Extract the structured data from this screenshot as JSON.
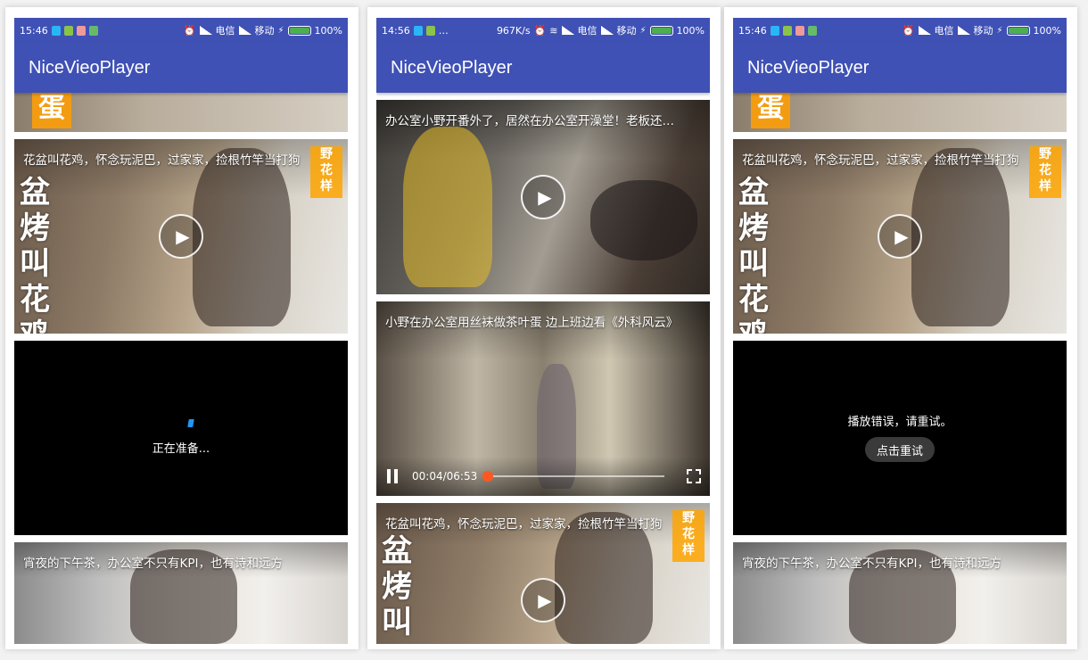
{
  "screens": [
    {
      "status": {
        "time": "15:46",
        "carrier1": "电信",
        "carrier2": "移动",
        "battery": "100%"
      },
      "app_title": "NiceVieoPlayer",
      "cards": {
        "flower_title": "花盆叫花鸡，怀念玩泥巴，过家家，捡根竹竿当打狗",
        "flower_poster": [
          "盆",
          "烤",
          "叫",
          "花",
          "鸡"
        ],
        "preparing": "正在准备...",
        "tea_title": "宵夜的下午茶，办公室不只有KPI，也有诗和远方",
        "dan_char": "蛋"
      }
    },
    {
      "status": {
        "time": "14:56",
        "speed": "967K/s",
        "carrier1": "电信",
        "carrier2": "移动",
        "battery": "100%"
      },
      "app_title": "NiceVieoPlayer",
      "cards": {
        "pig_title": "办公室小野开番外了，居然在办公室开澡堂！老板还…",
        "tea_egg_title": "小野在办公室用丝袜做茶叶蛋 边上班边看《外科风云》",
        "position": "00:04/06:53",
        "progress": 0.01,
        "flower_title": "花盆叫花鸡，怀念玩泥巴，过家家，捡根竹竿当打狗",
        "flower_poster": [
          "盆",
          "烤",
          "叫"
        ]
      }
    },
    {
      "status": {
        "time": "15:46",
        "carrier1": "电信",
        "carrier2": "移动",
        "battery": "100%"
      },
      "app_title": "NiceVieoPlayer",
      "cards": {
        "flower_title": "花盆叫花鸡，怀念玩泥巴，过家家，捡根竹竿当打狗",
        "flower_poster": [
          "盆",
          "烤",
          "叫",
          "花",
          "鸡"
        ],
        "error": "播放错误，请重试。",
        "retry": "点击重试",
        "tea_title": "宵夜的下午茶，办公室不只有KPI，也有诗和远方",
        "dan_char": "蛋"
      }
    }
  ]
}
